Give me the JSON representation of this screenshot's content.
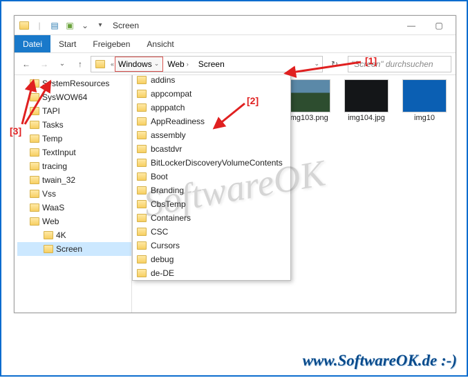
{
  "window": {
    "title": "Screen",
    "min": "—",
    "max": "▢",
    "close": "✕"
  },
  "ribbon": {
    "file": "Datei",
    "start": "Start",
    "share": "Freigeben",
    "view": "Ansicht"
  },
  "address": {
    "segA": "Windows",
    "segB": "Web",
    "segC": "Screen",
    "chev_double": "«"
  },
  "search": {
    "placeholder": "\"Screen\" durchsuchen"
  },
  "tree": {
    "items": [
      "SystemResources",
      "SysWOW64",
      "TAPI",
      "Tasks",
      "Temp",
      "TextInput",
      "tracing",
      "twain_32",
      "Vss",
      "WaaS",
      "Web"
    ],
    "sub": [
      "4K",
      "Screen"
    ]
  },
  "dropdown": {
    "items": [
      "addins",
      "appcompat",
      "apppatch",
      "AppReadiness",
      "assembly",
      "bcastdvr",
      "BitLockerDiscoveryVolumeContents",
      "Boot",
      "Branding",
      "CbsTemp",
      "Containers",
      "CSC",
      "Cursors",
      "debug",
      "de-DE"
    ]
  },
  "thumbs": [
    {
      "name": "img103.png",
      "cls": "landscape"
    },
    {
      "name": "img104.jpg",
      "cls": "dark"
    },
    {
      "name": "img10",
      "cls": "blue"
    }
  ],
  "annotations": {
    "a1": "[1]",
    "a2": "[2]",
    "a3": "[3]"
  },
  "watermark": "SoftwareOK",
  "footer": "www.SoftwareOK.de :-)"
}
